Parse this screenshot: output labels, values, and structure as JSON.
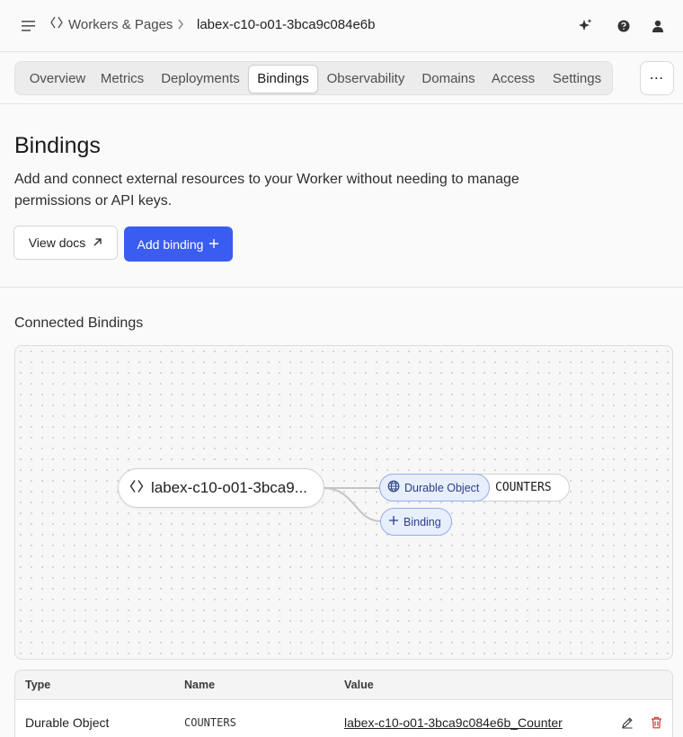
{
  "breadcrumb": {
    "parent": "Workers & Pages",
    "current": "labex-c10-o01-3bca9c084e6b"
  },
  "tabs": [
    {
      "label": "Overview"
    },
    {
      "label": "Metrics"
    },
    {
      "label": "Deployments"
    },
    {
      "label": "Bindings",
      "active": true
    },
    {
      "label": "Observability"
    },
    {
      "label": "Domains"
    },
    {
      "label": "Access"
    },
    {
      "label": "Settings"
    }
  ],
  "more_label": "⋯",
  "page": {
    "title": "Bindings",
    "description": "Add and connect external resources to your Worker without needing to manage permissions or API keys.",
    "view_docs_label": "View docs",
    "add_binding_label": "Add binding"
  },
  "connected": {
    "title": "Connected Bindings",
    "worker_node_label": "labex-c10-o01-3bca9...",
    "binding_type_label": "Durable Object",
    "binding_name": "COUNTERS",
    "add_pill_label": "Binding"
  },
  "table": {
    "headers": [
      "Type",
      "Name",
      "Value"
    ],
    "rows": [
      {
        "type": "Durable Object",
        "name": "COUNTERS",
        "value": "labex-c10-o01-3bca9c084e6b_Counter"
      }
    ]
  },
  "colors": {
    "accent": "#3b5cf0",
    "delete": "#d0312d",
    "pill_bg": "#e7eefc",
    "pill_border": "#93aee9"
  },
  "icons": [
    "menu-icon",
    "workers-icon",
    "chevron-right-icon",
    "sparkle-icon",
    "help-icon",
    "user-icon",
    "external-link-icon",
    "plus-icon",
    "globe-icon",
    "edit-icon",
    "trash-icon"
  ]
}
